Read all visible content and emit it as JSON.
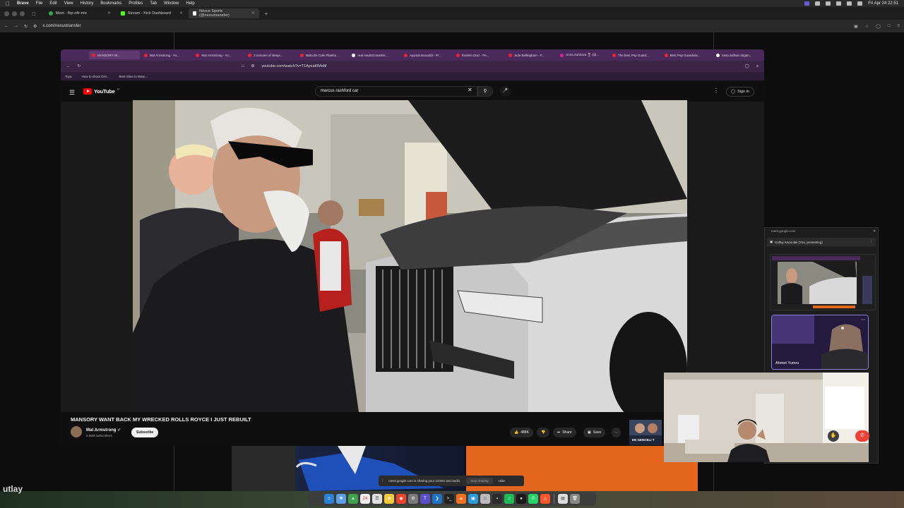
{
  "menubar": {
    "app": "Brave",
    "items": [
      "File",
      "Edit",
      "View",
      "History",
      "Bookmarks",
      "Profiles",
      "Tab",
      "Window",
      "Help"
    ],
    "clock": "Fri Apr 24  22:51"
  },
  "outer_browser": {
    "tabs": [
      {
        "label": "Meet - fbp-ofir-mic",
        "favicon_color": "#34a853"
      },
      {
        "label": "Stream - Kick Dashboard",
        "favicon_color": "#53fc18"
      },
      {
        "label": "Nexus Sports (@nexustransfer)",
        "favicon_color": "#ffffff"
      }
    ],
    "url": "x.com/nexustransfer"
  },
  "inner_browser": {
    "tabs": [
      "MANSORY W...",
      "Mat Armstrong - Yo...",
      "Mat Armstrong - Yo...",
      "3 minutes of sleepi...",
      "Malcolm Cole #futebo...",
      "real madrid transfer...",
      "Ayyoub Bouaddi - Pr...",
      "Ibrahim Diaz - Pe...",
      "Jude Bellingham - F...",
      "Anna Zubkova 🍷 (@...",
      "The best Pep Guard...",
      "Best Pep Guardiola...",
      "kasa ardhan dogan..."
    ],
    "url": "youtube.com/watch?v=T1Ayeat0MoM",
    "bookmarks": [
      "Toya",
      "How to shoot CIN...",
      "Best Sites to Wato..."
    ]
  },
  "youtube": {
    "logo_text": "YouTube",
    "logo_region": "PT",
    "search_value": "marcus rashford car",
    "signin_label": "Sign in",
    "video_title": "MANSORY WANT BACK MY WRECKED ROLLS ROYCE I JUST REBUILT",
    "channel_name": "Mat Armstrong",
    "channel_subs": "6.66M subscribers",
    "subscribe_label": "Subscribe",
    "likes": "488K",
    "share_label": "Share",
    "save_label": "Save",
    "endcard_text": "EN GENCELI T"
  },
  "meet": {
    "window_title": "meet.google.com",
    "presenting_label": "Kutluy Kacoulak (You, presenting)",
    "participant_name": "Ahmet Yumru"
  },
  "share_bar": {
    "message": "meet.google.com is sharing your screen and audio.",
    "stop_label": "Stop sharing",
    "hide_label": "Hide"
  },
  "side_text": "utlay",
  "colors": {
    "inner_chrome": "#4a2a5a",
    "yt_red": "#ff0000",
    "meet_hangup": "#ea4335",
    "jersey_orange": "#e4651e"
  }
}
